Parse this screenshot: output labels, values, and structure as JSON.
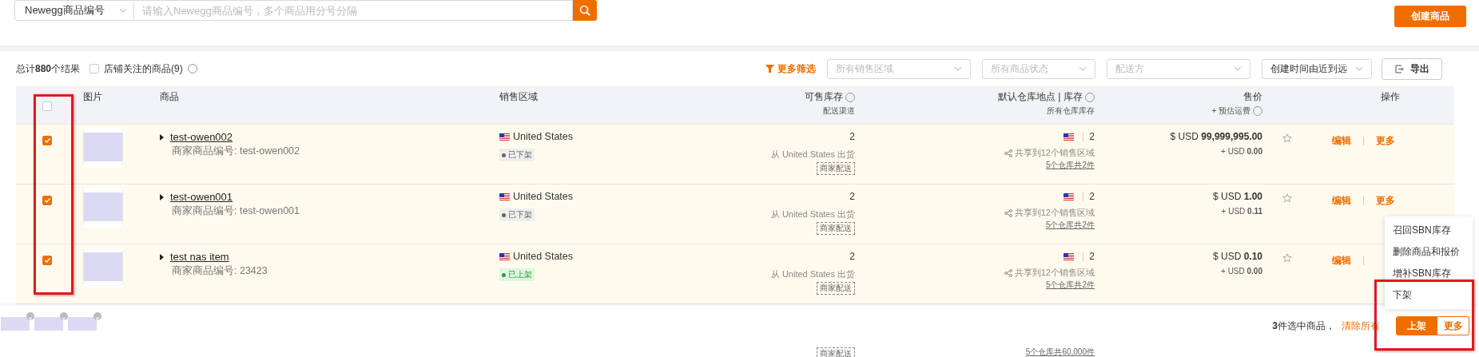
{
  "search": {
    "type_select": "Newegg商品编号",
    "placeholder": "请输入Newegg商品编号，多个商品用分号分隔"
  },
  "create_button": "创建商品",
  "toolbar": {
    "total": "总计**880**个结果",
    "follow_filter": {
      "label": "店铺关注的商品(9)",
      "checked": false
    },
    "more_filters": "更多筛选",
    "filters": [
      {
        "placeholder": "所有销售区域"
      },
      {
        "placeholder": "所有商品状态"
      },
      {
        "placeholder": "配送方"
      },
      {
        "value": "创建时间由近到远"
      }
    ],
    "export": "导出"
  },
  "table": {
    "select_all": false,
    "columns": [
      {
        "label": "图片"
      },
      {
        "label": "商品"
      },
      {
        "label": "销售区域"
      },
      {
        "label": "可售库存",
        "sub": "配送渠道",
        "help": true
      },
      {
        "label": "默认仓库地点 | 库存",
        "sub": "所有仓库库存",
        "help": true
      },
      {
        "label": "售价",
        "sub": "+ 预估运费",
        "help": true
      },
      {
        "label": "操作"
      }
    ],
    "rows": [
      {
        "selected": true,
        "name": "test-owen002",
        "sku": "商家商品编号: test-owen002",
        "region": "United States",
        "status": {
          "label": "已下架",
          "listed": false
        },
        "stock": "2",
        "ship_from": "从  United States 出货",
        "channel": "商家配送",
        "wh_stock": "2",
        "shared": "共享到12个销售区域",
        "wh_total": "5个仓库共2件",
        "price": "$ USD **99,999,995.00**",
        "shipping": "+ USD **0.00**",
        "starred": false,
        "edit": "编辑",
        "more": "更多"
      },
      {
        "selected": true,
        "name": "test-owen001",
        "sku": "商家商品编号: test-owen001",
        "region": "United States",
        "status": {
          "label": "已下架",
          "listed": false
        },
        "stock": "2",
        "ship_from": "从  United States 出货",
        "channel": "商家配送",
        "wh_stock": "2",
        "shared": "共享到12个销售区域",
        "wh_total": "5个仓库共2件",
        "price": "$ USD **1.00**",
        "shipping": "+ USD **0.11**",
        "starred": false,
        "edit": "编辑",
        "more": "更多"
      },
      {
        "selected": true,
        "name": "test nas item",
        "sku": "商家商品编号: 23423",
        "region": "United States",
        "status": {
          "label": "已上架",
          "listed": true
        },
        "stock": "2",
        "ship_from": "从  United States 出货",
        "channel": "商家配送",
        "wh_stock": "2",
        "shared": "共享到12个销售区域",
        "wh_total": "5个仓库共2件",
        "price": "$ USD **0.10**",
        "shipping": "+ USD **0.00**",
        "starred": false,
        "edit": "编辑"
      }
    ],
    "partial_row": {
      "channel": "商家配送",
      "wh_total": "5个仓库共60,000件"
    }
  },
  "more_menu": [
    "召回SBN库存",
    "删除商品和报价",
    "增补SBN库存",
    "下架"
  ],
  "bulk_bar": {
    "thumbnails": [
      {
        "kind": "image"
      },
      {
        "kind": "image"
      },
      {
        "kind": "image"
      }
    ],
    "count": "**3**件选中商品，",
    "clear": "清除所有",
    "primary": "上架",
    "more": "更多"
  }
}
